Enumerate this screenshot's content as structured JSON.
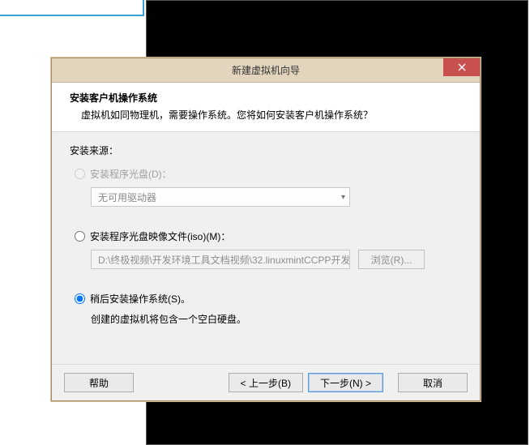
{
  "dialog": {
    "title": "新建虚拟机向导",
    "header_title": "安装客户机操作系统",
    "header_sub": "虚拟机如同物理机，需要操作系统。您将如何安装客户机操作系统？"
  },
  "source": {
    "label": "安装来源：",
    "opt_disc": {
      "label": "安装程序光盘(D)：",
      "drive_text": "无可用驱动器"
    },
    "opt_iso": {
      "label": "安装程序光盘映像文件(iso)(M)：",
      "path": "D:\\终极视频\\开发环境工具文档视频\\32.linuxmintCCPP开发",
      "browse": "浏览(R)..."
    },
    "opt_later": {
      "label": "稍后安装操作系统(S)。",
      "hint": "创建的虚拟机将包含一个空白硬盘。"
    }
  },
  "footer": {
    "help": "帮助",
    "back": "< 上一步(B)",
    "next": "下一步(N) >",
    "cancel": "取消"
  }
}
